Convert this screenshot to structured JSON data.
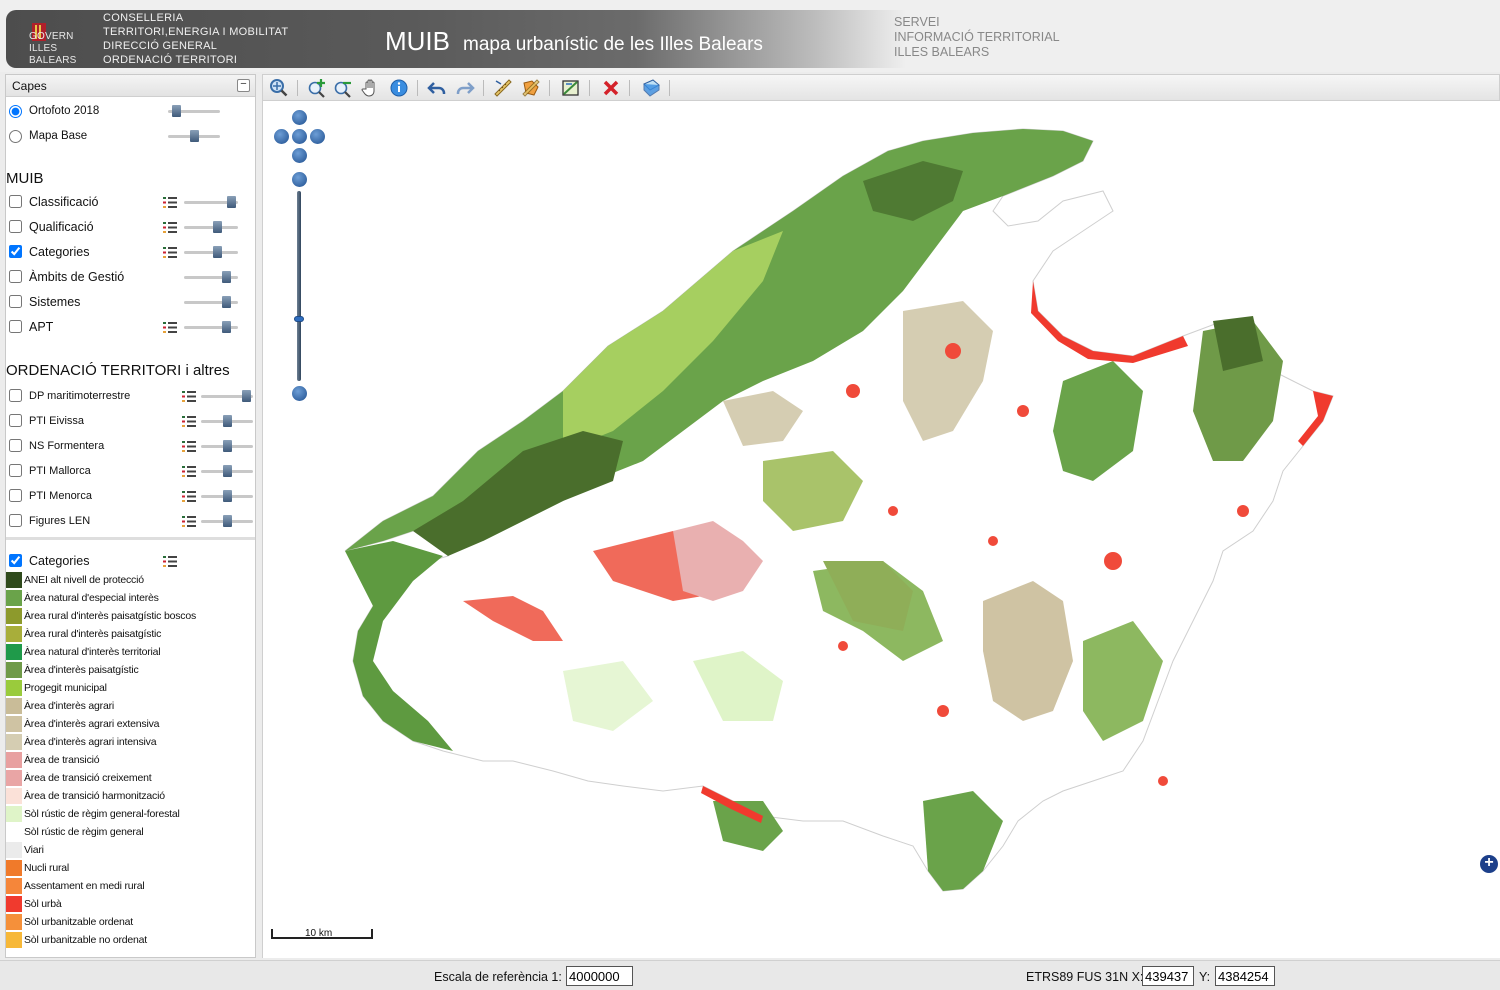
{
  "header": {
    "gov_lines": [
      "GOVERN",
      "ILLES",
      "BALEARS"
    ],
    "conselleria_lines": [
      "CONSELLERIA",
      "TERRITORI,ENERGIA I MOBILITAT",
      "DIRECCIÓ GENERAL",
      "ORDENACIÓ TERRITORI"
    ],
    "app_name": "MUIB",
    "app_subtitle": "mapa urbanístic de les Illes Balears",
    "servei_lines": [
      "SERVEI",
      "INFORMACIÓ TERRITORIAL",
      "ILLES BALEARS"
    ]
  },
  "panel": {
    "title": "Capes",
    "collapse_label": "−",
    "base_layers": [
      {
        "label": "Ortofoto 2018",
        "selected": true,
        "opacity": 0.15
      },
      {
        "label": "Mapa Base",
        "selected": false,
        "opacity": 0.5
      }
    ],
    "muib_title": "MUIB",
    "muib_layers": [
      {
        "label": "Classificació",
        "checked": false,
        "legend": true,
        "opacity": 0.95
      },
      {
        "label": "Qualificació",
        "checked": false,
        "legend": true,
        "opacity": 0.65
      },
      {
        "label": "Categories",
        "checked": true,
        "legend": true,
        "opacity": 0.65
      },
      {
        "label": "Àmbits de Gestió",
        "checked": false,
        "legend": false,
        "opacity": 0.85
      },
      {
        "label": "Sistemes",
        "checked": false,
        "legend": false,
        "opacity": 0.85
      },
      {
        "label": "APT",
        "checked": false,
        "legend": true,
        "opacity": 0.85
      }
    ],
    "ot_title": "ORDENACIÓ TERRITORI i altres",
    "ot_layers": [
      {
        "label": "DP maritimoterrestre",
        "checked": false,
        "legend": true,
        "opacity": 0.95
      },
      {
        "label": "PTI Eivissa",
        "checked": false,
        "legend": true,
        "opacity": 0.5
      },
      {
        "label": "NS Formentera",
        "checked": false,
        "legend": true,
        "opacity": 0.5
      },
      {
        "label": "PTI Mallorca",
        "checked": false,
        "legend": true,
        "opacity": 0.5
      },
      {
        "label": "PTI Menorca",
        "checked": false,
        "legend": true,
        "opacity": 0.5
      },
      {
        "label": "Figures LEN",
        "checked": false,
        "legend": true,
        "opacity": 0.5
      }
    ],
    "legend_title": "Categories",
    "legend_checked": true,
    "legend_items": [
      {
        "label": "ANEI alt nivell de protecció",
        "color": "#2f4a1c"
      },
      {
        "label": "Àrea natural d'especial interès",
        "color": "#6aa34a"
      },
      {
        "label": "Àrea rural d'interès paisatgístic boscos",
        "color": "#8d9a2c"
      },
      {
        "label": "Àrea rural d'interès paisatgístic",
        "color": "#a8ae3a"
      },
      {
        "label": "Àrea natural d'interès territorial",
        "color": "#1f9a4a"
      },
      {
        "label": "Àrea d'interès paisatgístic",
        "color": "#6f9a48"
      },
      {
        "label": "Progegit municipal",
        "color": "#9acb3c"
      },
      {
        "label": "Àrea d'interès agrari",
        "color": "#c9bc98"
      },
      {
        "label": "Àrea d'interès agrari extensiva",
        "color": "#cfc3a3"
      },
      {
        "label": "Àrea d'interès agrari intensiva",
        "color": "#d5cdb2"
      },
      {
        "label": "Àrea de transició",
        "color": "#e8a0a0"
      },
      {
        "label": "Àrea de transició creixement",
        "color": "#e9a5a5"
      },
      {
        "label": "Àrea de transició harmonització",
        "color": "#fbe1d8"
      },
      {
        "label": "Sòl rústic de règim general-forestal",
        "color": "#dff4c8"
      },
      {
        "label": "Sòl rústic de règim general",
        "color": "#ffffff"
      },
      {
        "label": "Viari",
        "color": "#ebebeb"
      },
      {
        "label": "Nucli rural",
        "color": "#f07a2a"
      },
      {
        "label": "Assentament en medi rural",
        "color": "#f5863a"
      },
      {
        "label": "Sòl urbà",
        "color": "#f03a2e"
      },
      {
        "label": "Sòl urbanitzable ordenat",
        "color": "#f5903a"
      },
      {
        "label": "Sòl urbanitzable no ordenat",
        "color": "#f7b838"
      }
    ]
  },
  "toolbar": {
    "tools": [
      "zoom-extent",
      "zoom-in",
      "zoom-out",
      "pan",
      "info",
      "undo",
      "redo",
      "measure-line",
      "measure-area",
      "select-area",
      "clear",
      "print"
    ]
  },
  "map": {
    "scale_label": "10 km",
    "expand_label": "+"
  },
  "status": {
    "scale_ref_label": "Escala de referència 1:",
    "scale_ref_value": "4000000",
    "coord_label": "ETRS89 FUS 31N X:",
    "x_value": "439437",
    "y_label": "Y:",
    "y_value": "4384254"
  }
}
